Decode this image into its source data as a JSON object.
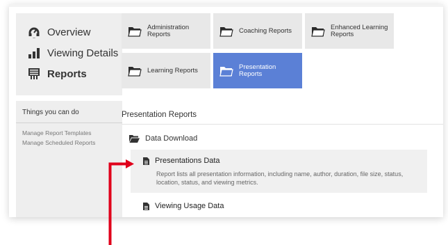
{
  "sidebar": {
    "nav": [
      {
        "label": "Overview",
        "icon": "overview-dashboard-icon",
        "active": false
      },
      {
        "label": "Viewing Details",
        "icon": "bar-chart-icon",
        "active": false
      },
      {
        "label": "Reports",
        "icon": "report-icon",
        "active": true
      }
    ],
    "things": {
      "title": "Things you can do",
      "links": [
        "Manage Report Templates",
        "Manage Scheduled Reports"
      ]
    }
  },
  "tiles": [
    {
      "label": "Administration Reports",
      "active": false
    },
    {
      "label": "Coaching Reports",
      "active": false
    },
    {
      "label": "Enhanced Learning Reports",
      "active": false
    },
    {
      "label": "Learning Reports",
      "active": false
    },
    {
      "label": "Presentation Reports",
      "active": true
    }
  ],
  "main": {
    "section_title": "Presentation Reports",
    "group": "Data Download",
    "reports": [
      {
        "title": "Presentations Data",
        "description": "Report lists all presentation information, including name, author, duration, file size, status, location, status, and viewing metrics."
      },
      {
        "title": "Viewing Usage Data",
        "description": ""
      }
    ]
  },
  "colors": {
    "accent_tile": "#5b80d6",
    "annotation_arrow": "#e0001b",
    "panel_bg": "#eeeeee"
  }
}
